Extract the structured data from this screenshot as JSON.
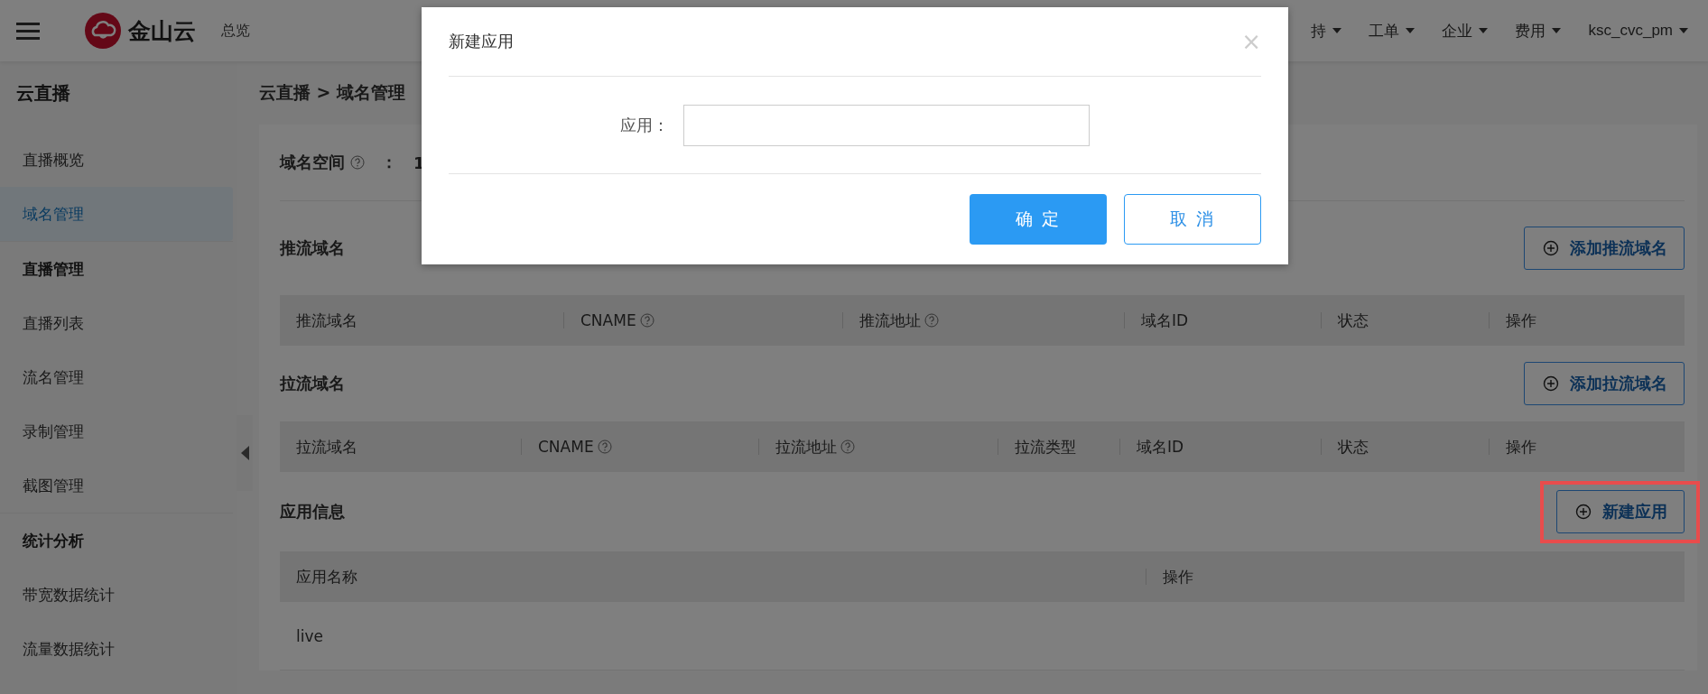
{
  "topbar": {
    "brand": "金山云",
    "nav_left": [
      {
        "label": "总览"
      }
    ],
    "nav_right": [
      {
        "label": "持"
      },
      {
        "label": "工单"
      },
      {
        "label": "企业"
      },
      {
        "label": "费用"
      },
      {
        "label": "ksc_cvc_pm"
      }
    ]
  },
  "sidebar": {
    "title": "云直播",
    "items": [
      {
        "kind": "link",
        "label": "直播概览",
        "selected": false
      },
      {
        "kind": "link",
        "label": "域名管理",
        "selected": true
      },
      {
        "kind": "heading",
        "label": "直播管理",
        "selected": false
      },
      {
        "kind": "link",
        "label": "直播列表",
        "selected": false
      },
      {
        "kind": "link",
        "label": "流名管理",
        "selected": false
      },
      {
        "kind": "link",
        "label": "录制管理",
        "selected": false
      },
      {
        "kind": "link",
        "label": "截图管理",
        "selected": false
      },
      {
        "kind": "heading",
        "label": "统计分析",
        "selected": false
      },
      {
        "kind": "link",
        "label": "带宽数据统计",
        "selected": false
      },
      {
        "kind": "link",
        "label": "流量数据统计",
        "selected": false
      }
    ]
  },
  "breadcrumb": "云直播 > 域名管理",
  "domain_space": {
    "label": "域名空间",
    "separator": "：",
    "value": "1"
  },
  "sections": [
    {
      "title": "推流域名",
      "button": "添加推流域名",
      "highlighted": false,
      "columns": [
        {
          "label": "推流域名",
          "help": false
        },
        {
          "label": "CNAME",
          "help": true
        },
        {
          "label": "推流地址",
          "help": true
        },
        {
          "label": "域名ID",
          "help": false
        },
        {
          "label": "状态",
          "help": false
        },
        {
          "label": "操作",
          "help": false
        }
      ]
    },
    {
      "title": "拉流域名",
      "button": "添加拉流域名",
      "highlighted": false,
      "columns": [
        {
          "label": "拉流域名",
          "help": false
        },
        {
          "label": "CNAME",
          "help": true
        },
        {
          "label": "拉流地址",
          "help": true
        },
        {
          "label": "拉流类型",
          "help": false
        },
        {
          "label": "域名ID",
          "help": false
        },
        {
          "label": "状态",
          "help": false
        },
        {
          "label": "操作",
          "help": false
        }
      ]
    },
    {
      "title": "应用信息",
      "button": "新建应用",
      "highlighted": true,
      "columns": [
        {
          "label": "应用名称",
          "help": false
        },
        {
          "label": "操作",
          "help": false
        }
      ],
      "rows": [
        [
          "live",
          ""
        ]
      ]
    }
  ],
  "dialog": {
    "title": "新建应用",
    "close": "×",
    "field_label": "应用：",
    "buttons": [
      {
        "kind": "primary",
        "label": "确 定"
      },
      {
        "kind": "secondary",
        "label": "取 消"
      }
    ]
  }
}
